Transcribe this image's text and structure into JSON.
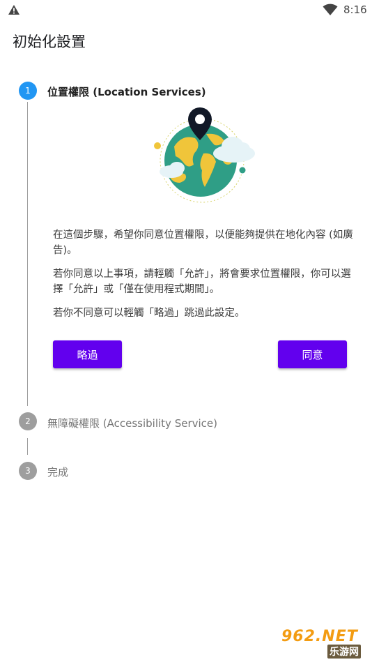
{
  "status_bar": {
    "time": "8:16",
    "icons": [
      "warning-icon",
      "wifi-icon"
    ]
  },
  "header": {
    "title": "初始化設置"
  },
  "steps": [
    {
      "number": "1",
      "title": "位置權限 (Location Services)",
      "state": "active"
    },
    {
      "number": "2",
      "title": "無障礙權限 (Accessibility Service)",
      "state": "inactive"
    },
    {
      "number": "3",
      "title": "完成",
      "state": "inactive"
    }
  ],
  "step1": {
    "illustration": "globe-location-pin-illustration",
    "paragraphs": [
      "在這個步驟，希望你同意位置權限，以便能夠提供在地化內容 (如廣告)。",
      "若你同意以上事項，請輕觸「允許」，將會要求位置權限，你可以選擇「允許」或「僅在使用程式期間」。",
      "若你不同意可以輕觸「略過」跳過此設定。"
    ],
    "skip_label": "略過",
    "agree_label": "同意"
  },
  "watermark": {
    "main": "962.NET",
    "sub": "乐游网"
  },
  "colors": {
    "accent_button": "#6200ee",
    "active_step": "#2196f3",
    "inactive_step": "#9e9e9e"
  }
}
